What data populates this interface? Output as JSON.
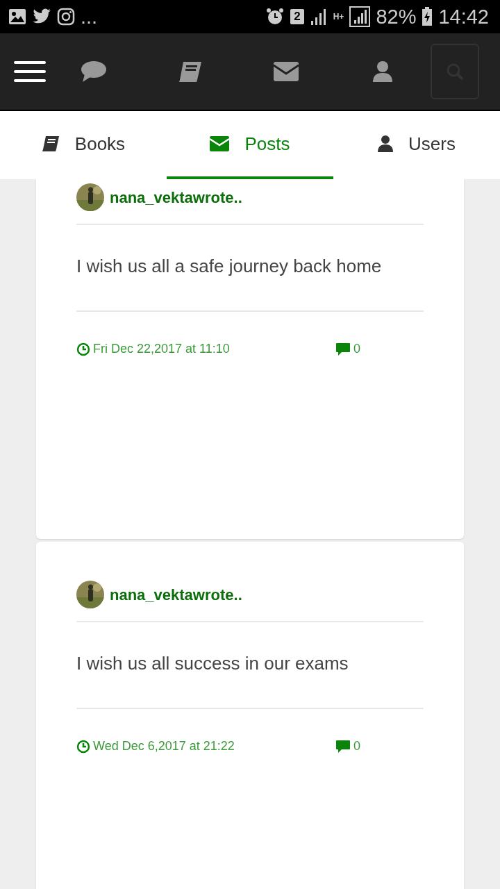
{
  "status_bar": {
    "more": "...",
    "sim": "2",
    "network": "H+",
    "battery": "82%",
    "time": "14:42"
  },
  "tabs": [
    {
      "label": "Books",
      "kind": "book",
      "selected": false
    },
    {
      "label": "Posts",
      "kind": "envelope",
      "selected": true
    },
    {
      "label": "Users",
      "kind": "user",
      "selected": false
    }
  ],
  "posts": [
    {
      "author": "nana_vektawrote..",
      "text": "I wish us all a safe journey back home",
      "date": "Fri Dec 22,2017 at 11:10",
      "comments": "0"
    },
    {
      "author": "nana_vektawrote..",
      "text": "I wish us all success in our exams",
      "date": "Wed Dec 6,2017 at 21:22",
      "comments": "0"
    }
  ]
}
